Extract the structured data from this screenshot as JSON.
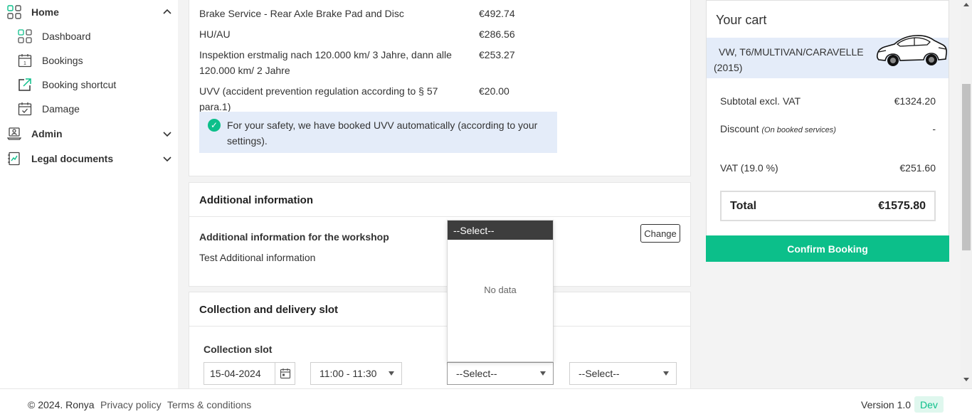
{
  "sidebar": {
    "home": "Home",
    "items": [
      {
        "label": "Dashboard"
      },
      {
        "label": "Bookings"
      },
      {
        "label": "Booking shortcut"
      },
      {
        "label": "Damage"
      }
    ],
    "admin": "Admin",
    "legal": "Legal documents"
  },
  "services": [
    {
      "name": "Brake Service - Rear Axle Brake Pad and Disc",
      "price": "€492.74"
    },
    {
      "name": "HU/AU",
      "price": "€286.56"
    },
    {
      "name": "Inspektion erstmalig nach 120.000 km/ 3 Jahre, dann alle 120.000 km/ 2 Jahre",
      "price": "€253.27"
    },
    {
      "name": "UVV (accident prevention regulation according to § 57 para.1)",
      "price": "€20.00"
    }
  ],
  "notice": "For your safety, we have booked UVV automatically (according to your settings).",
  "additional": {
    "title": "Additional information",
    "label": "Additional information for the workshop",
    "value": "Test Additional information",
    "change": "Change"
  },
  "collection": {
    "title": "Collection and delivery slot",
    "slot_label": "Collection slot",
    "date": "15-04-2024",
    "time": "11:00 - 11:30",
    "select1": "--Select--",
    "select2": "--Select--"
  },
  "dropdown": {
    "header": "--Select--",
    "empty": "No data"
  },
  "cart": {
    "title": "Your cart",
    "vehicle": "VW, T6/MULTIVAN/CARAVELLE (2015)",
    "subtotal_label": "Subtotal excl. VAT",
    "subtotal": "€1324.20",
    "discount_label": "Discount",
    "discount_note": "(On booked services)",
    "discount": "-",
    "vat_label": "VAT (19.0 %)",
    "vat": "€251.60",
    "total_label": "Total",
    "total": "€1575.80",
    "confirm": "Confirm Booking"
  },
  "footer": {
    "copyright": "© 2024. Ronya",
    "privacy": "Privacy policy",
    "terms": "Terms & conditions",
    "version": "Version 1.0",
    "env": "Dev"
  },
  "colors": {
    "accent": "#0cbf8a",
    "notice_bg": "#e4ecf9"
  }
}
